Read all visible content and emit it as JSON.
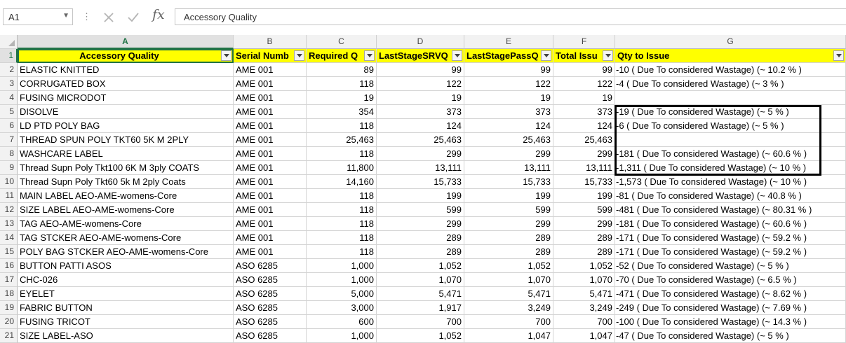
{
  "formula_bar": {
    "name_box": "A1",
    "name_box_dropdown_icon": "chevron-down-icon",
    "cancel_icon": "close-icon",
    "enter_icon": "check-icon",
    "function_icon": "fx-icon",
    "function_label": "fx",
    "content": "Accessory Quality"
  },
  "sheet": {
    "columns": [
      "A",
      "B",
      "C",
      "D",
      "E",
      "F",
      "G"
    ],
    "header_row": {
      "row_number": "1",
      "cells": [
        "Accessory Quality",
        "Serial Numb",
        "Required Q",
        "LastStageSRVQ",
        "LastStagePassQ",
        "Total Issu",
        "Qty to Issue"
      ]
    },
    "header_fill_color": "#ffff00",
    "selection_color": "#217346",
    "rows": [
      {
        "n": "2",
        "a": "ELASTIC KNITTED",
        "b": "AME 001",
        "c": "89",
        "d": "99",
        "e": "99",
        "f": "99",
        "g": "-10 ( Due To considered Wastage) (~ 10.2 % )"
      },
      {
        "n": "3",
        "a": "CORRUGATED BOX",
        "b": "AME 001",
        "c": "118",
        "d": "122",
        "e": "122",
        "f": "122",
        "g": "-4 ( Due To considered Wastage) (~ 3 % )"
      },
      {
        "n": "4",
        "a": "FUSING MICRODOT",
        "b": "AME 001",
        "c": "19",
        "d": "19",
        "e": "19",
        "f": "19",
        "g": ""
      },
      {
        "n": "5",
        "a": "DISOLVE",
        "b": "AME 001",
        "c": "354",
        "d": "373",
        "e": "373",
        "f": "373",
        "g": "-19 ( Due To considered Wastage) (~ 5 % )"
      },
      {
        "n": "6",
        "a": "LD PTD POLY BAG",
        "b": "AME 001",
        "c": "118",
        "d": "124",
        "e": "124",
        "f": "124",
        "g": "-6 ( Due To considered Wastage) (~ 5 % )"
      },
      {
        "n": "7",
        "a": "THREAD SPUN POLY TKT60 5K M 2PLY",
        "b": "AME 001",
        "c": "25,463",
        "d": "25,463",
        "e": "25,463",
        "f": "25,463",
        "g": ""
      },
      {
        "n": "8",
        "a": "WASHCARE LABEL",
        "b": "AME 001",
        "c": "118",
        "d": "299",
        "e": "299",
        "f": "299",
        "g": "-181 ( Due To considered Wastage) (~ 60.6 % )"
      },
      {
        "n": "9",
        "a": "Thread Supn Poly Tkt100 6K M 3ply COATS",
        "b": "AME 001",
        "c": "11,800",
        "d": "13,111",
        "e": "13,111",
        "f": "13,111",
        "g": "-1,311 ( Due To considered Wastage) (~ 10 % )"
      },
      {
        "n": "10",
        "a": "Thread Supn Poly Tkt60 5k M 2ply Coats",
        "b": "AME 001",
        "c": "14,160",
        "d": "15,733",
        "e": "15,733",
        "f": "15,733",
        "g": "-1,573 ( Due To considered Wastage) (~ 10 % )"
      },
      {
        "n": "11",
        "a": "MAIN LABEL AEO-AME-womens-Core",
        "b": "AME 001",
        "c": "118",
        "d": "199",
        "e": "199",
        "f": "199",
        "g": "-81 ( Due To considered Wastage) (~ 40.8 % )"
      },
      {
        "n": "12",
        "a": "SIZE LABEL AEO-AME-womens-Core",
        "b": "AME 001",
        "c": "118",
        "d": "599",
        "e": "599",
        "f": "599",
        "g": "-481 ( Due To considered Wastage) (~ 80.31 % )"
      },
      {
        "n": "13",
        "a": "TAG AEO-AME-womens-Core",
        "b": "AME 001",
        "c": "118",
        "d": "299",
        "e": "299",
        "f": "299",
        "g": "-181 ( Due To considered Wastage) (~ 60.6 % )"
      },
      {
        "n": "14",
        "a": "TAG STCKER AEO-AME-womens-Core",
        "b": "AME 001",
        "c": "118",
        "d": "289",
        "e": "289",
        "f": "289",
        "g": "-171 ( Due To considered Wastage) (~ 59.2 % )"
      },
      {
        "n": "15",
        "a": "POLY BAG STCKER AEO-AME-womens-Core",
        "b": "AME 001",
        "c": "118",
        "d": "289",
        "e": "289",
        "f": "289",
        "g": "-171 ( Due To considered Wastage) (~ 59.2 % )"
      },
      {
        "n": "16",
        "a": "BUTTON PATTI ASOS",
        "b": "ASO 6285",
        "c": "1,000",
        "d": "1,052",
        "e": "1,052",
        "f": "1,052",
        "g": "-52 ( Due To considered Wastage) (~ 5 % )"
      },
      {
        "n": "17",
        "a": "CHC-026",
        "b": "ASO 6285",
        "c": "1,000",
        "d": "1,070",
        "e": "1,070",
        "f": "1,070",
        "g": "-70 ( Due To considered Wastage) (~ 6.5 % )"
      },
      {
        "n": "18",
        "a": "EYELET",
        "b": "ASO 6285",
        "c": "5,000",
        "d": "5,471",
        "e": "5,471",
        "f": "5,471",
        "g": "-471 ( Due To considered Wastage) (~ 8.62 % )"
      },
      {
        "n": "19",
        "a": "FABRIC BUTTON",
        "b": "ASO 6285",
        "c": "3,000",
        "d": "1,917",
        "e": "3,249",
        "f": "3,249",
        "g": "-249 ( Due To considered Wastage) (~ 7.69 % )"
      },
      {
        "n": "20",
        "a": "FUSING TRICOT",
        "b": "ASO 6285",
        "c": "600",
        "d": "700",
        "e": "700",
        "f": "700",
        "g": "-100 ( Due To considered Wastage) (~ 14.3 % )"
      },
      {
        "n": "21",
        "a": "SIZE LABEL-ASO",
        "b": "ASO 6285",
        "c": "1,000",
        "d": "1,052",
        "e": "1,047",
        "f": "1,047",
        "g": "-47 ( Due To considered Wastage) (~ 5 % )"
      }
    ]
  }
}
